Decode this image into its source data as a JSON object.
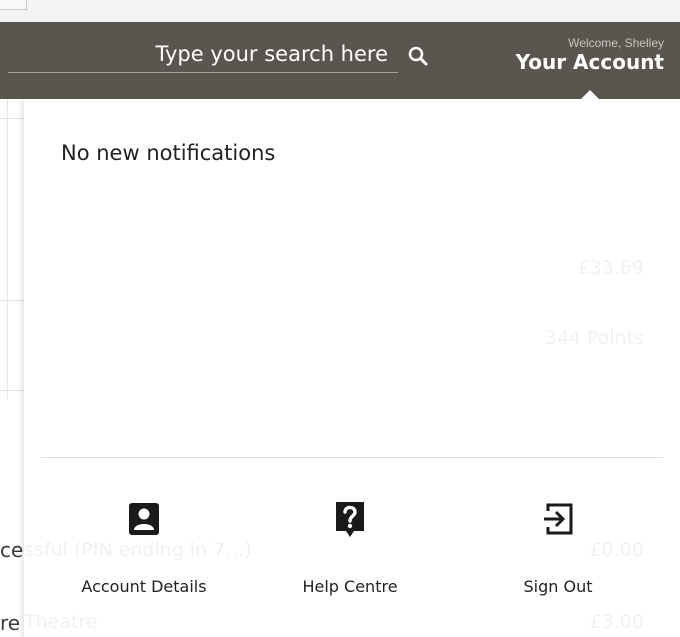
{
  "header": {
    "search": {
      "placeholder": "Type your search here"
    },
    "account": {
      "welcome": "Welcome, Shelley",
      "label": "Your Account"
    }
  },
  "background": {
    "amount_1": "£33.69",
    "points": "344 Points",
    "row_1_left": "ce",
    "row_1_mid": "ssful (PIN ending in 7…)",
    "row_1_amount": "£0.00",
    "row_2_left": "re",
    "row_2_mid": "Theatre",
    "row_2_amount": "£3.00"
  },
  "dropdown": {
    "notifications_text": "No new notifications",
    "actions": [
      {
        "label": "Account Details",
        "icon": "account-details-icon"
      },
      {
        "label": "Help Centre",
        "icon": "help-centre-icon"
      },
      {
        "label": "Sign Out",
        "icon": "sign-out-icon"
      }
    ]
  },
  "colors": {
    "header_bg": "#5b554f",
    "text_dark": "#222222",
    "icon_dark": "#1a1a1a"
  }
}
